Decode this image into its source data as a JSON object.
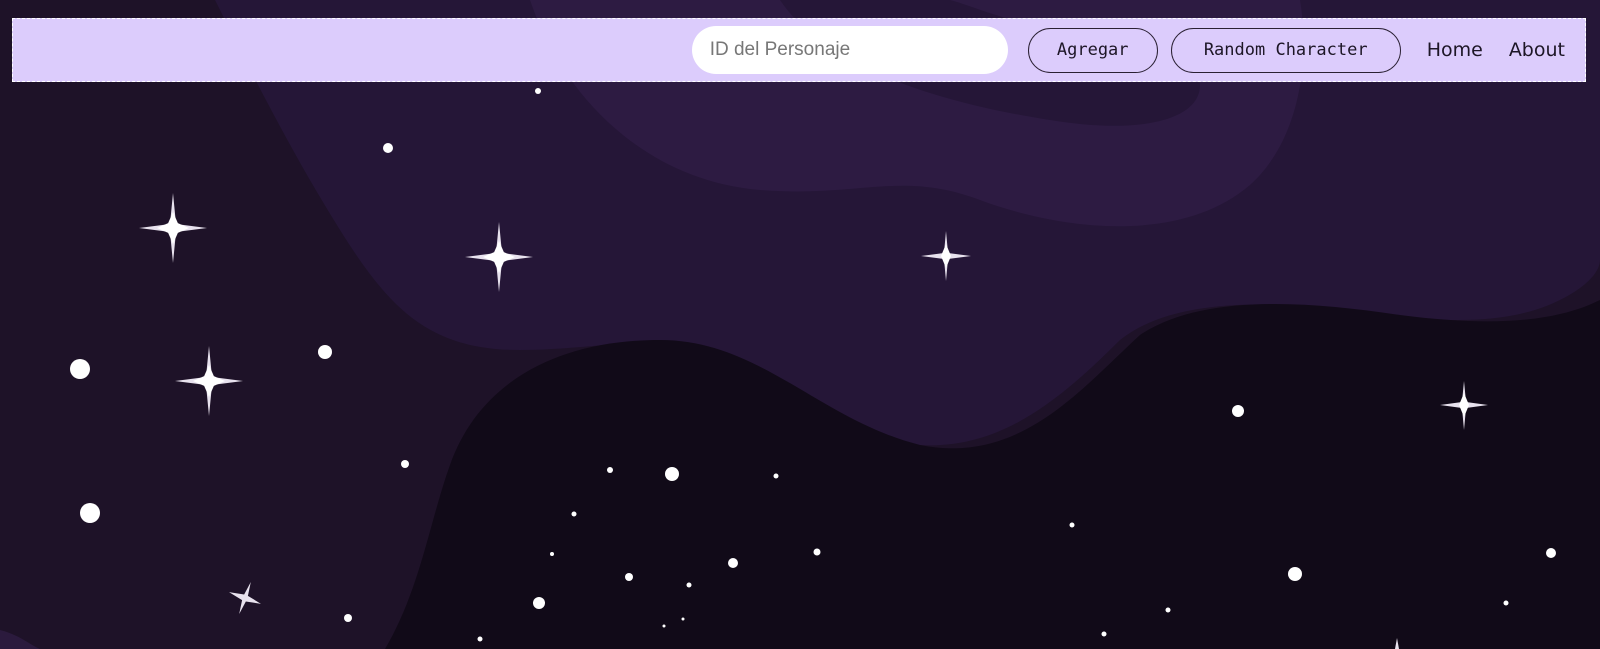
{
  "navbar": {
    "search": {
      "placeholder": "ID del Personaje",
      "value": ""
    },
    "add_label": "Agregar",
    "random_label": "Random Character",
    "links": {
      "home": "Home",
      "about": "About"
    }
  },
  "colors": {
    "background": "#1e1228",
    "navbar": "#dcccfc",
    "wave_light": "#2b1a40",
    "wave_dark": "#110a18",
    "star": "#ffffff"
  }
}
